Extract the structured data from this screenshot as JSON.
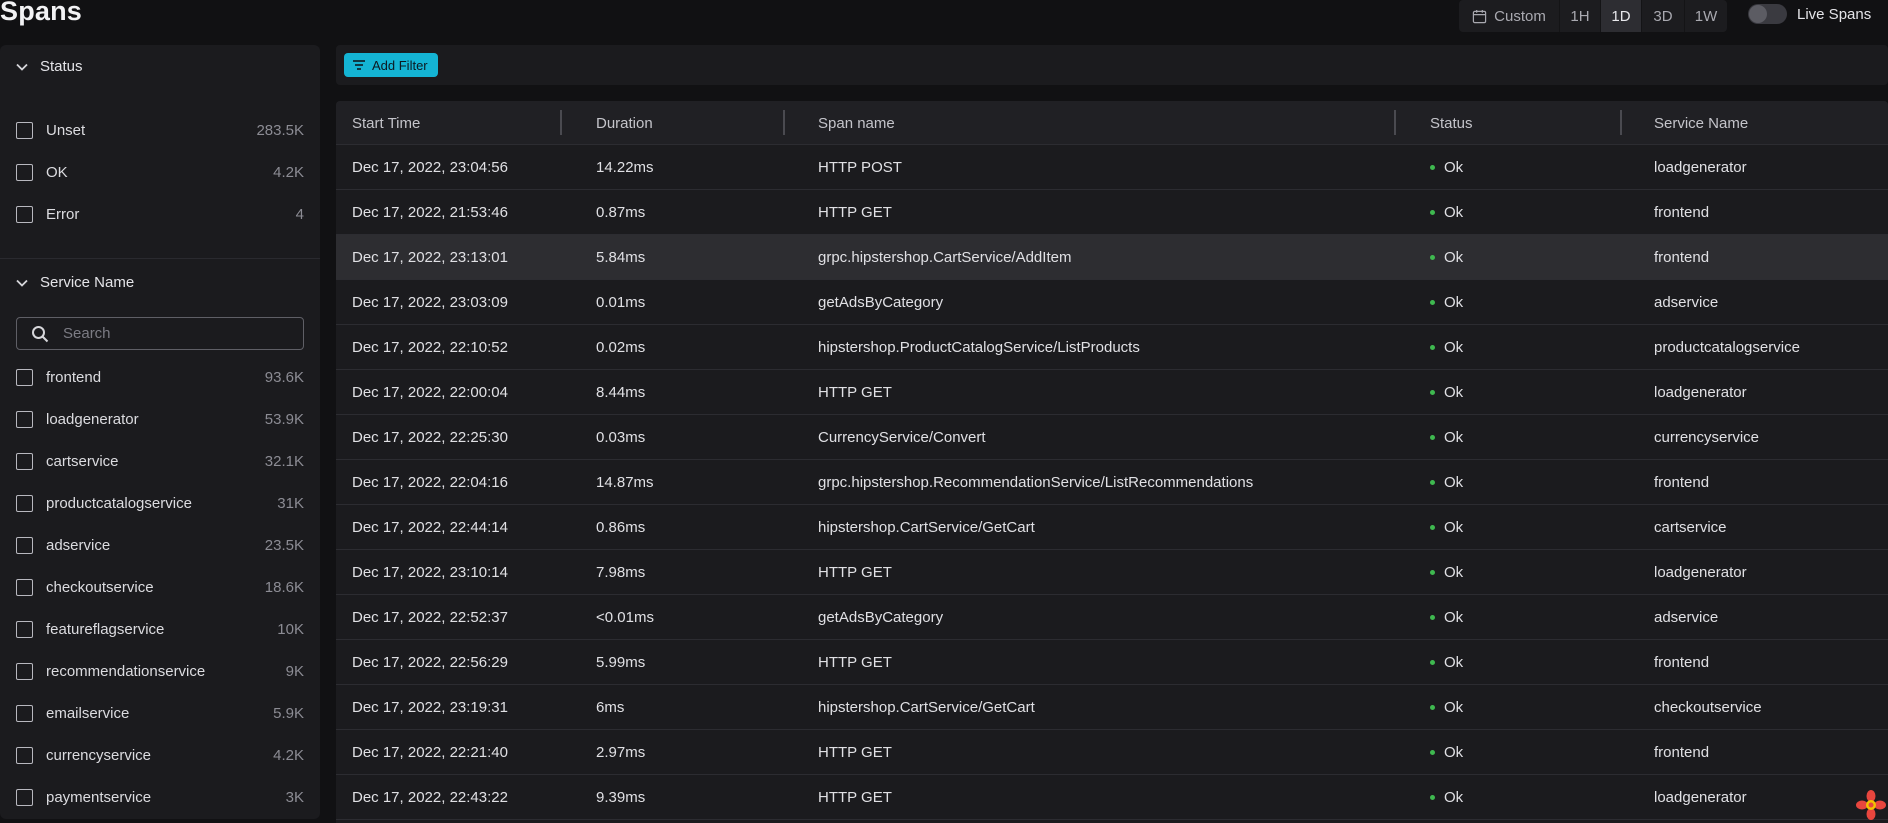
{
  "page": {
    "title": "Spans"
  },
  "time_range": {
    "options": [
      "Custom",
      "1H",
      "1D",
      "3D",
      "1W"
    ],
    "selected": "1D",
    "live_label": "Live Spans",
    "live_enabled": false
  },
  "filters": {
    "add_filter_label": "Add Filter",
    "status": {
      "title": "Status",
      "items": [
        {
          "label": "Unset",
          "count": "283.5K"
        },
        {
          "label": "OK",
          "count": "4.2K"
        },
        {
          "label": "Error",
          "count": "4"
        }
      ]
    },
    "service": {
      "title": "Service Name",
      "search_placeholder": "Search",
      "items": [
        {
          "label": "frontend",
          "count": "93.6K"
        },
        {
          "label": "loadgenerator",
          "count": "53.9K"
        },
        {
          "label": "cartservice",
          "count": "32.1K"
        },
        {
          "label": "productcatalogservice",
          "count": "31K"
        },
        {
          "label": "adservice",
          "count": "23.5K"
        },
        {
          "label": "checkoutservice",
          "count": "18.6K"
        },
        {
          "label": "featureflagservice",
          "count": "10K"
        },
        {
          "label": "recommendationservice",
          "count": "9K"
        },
        {
          "label": "emailservice",
          "count": "5.9K"
        },
        {
          "label": "currencyservice",
          "count": "4.2K"
        },
        {
          "label": "paymentservice",
          "count": "3K"
        }
      ]
    }
  },
  "table": {
    "columns": [
      "Start Time",
      "Duration",
      "Span name",
      "Status",
      "Service Name"
    ],
    "rows": [
      {
        "start": "Dec 17, 2022, 23:04:56",
        "duration": "14.22ms",
        "name": "HTTP POST",
        "status": "Ok",
        "service": "loadgenerator"
      },
      {
        "start": "Dec 17, 2022, 21:53:46",
        "duration": "0.87ms",
        "name": "HTTP GET",
        "status": "Ok",
        "service": "frontend"
      },
      {
        "start": "Dec 17, 2022, 23:13:01",
        "duration": "5.84ms",
        "name": "grpc.hipstershop.CartService/AddItem",
        "status": "Ok",
        "service": "frontend"
      },
      {
        "start": "Dec 17, 2022, 23:03:09",
        "duration": "0.01ms",
        "name": "getAdsByCategory",
        "status": "Ok",
        "service": "adservice"
      },
      {
        "start": "Dec 17, 2022, 22:10:52",
        "duration": "0.02ms",
        "name": "hipstershop.ProductCatalogService/ListProducts",
        "status": "Ok",
        "service": "productcatalogservice"
      },
      {
        "start": "Dec 17, 2022, 22:00:04",
        "duration": "8.44ms",
        "name": "HTTP GET",
        "status": "Ok",
        "service": "loadgenerator"
      },
      {
        "start": "Dec 17, 2022, 22:25:30",
        "duration": "0.03ms",
        "name": "CurrencyService/Convert",
        "status": "Ok",
        "service": "currencyservice"
      },
      {
        "start": "Dec 17, 2022, 22:04:16",
        "duration": "14.87ms",
        "name": "grpc.hipstershop.RecommendationService/ListRecommendations",
        "status": "Ok",
        "service": "frontend"
      },
      {
        "start": "Dec 17, 2022, 22:44:14",
        "duration": "0.86ms",
        "name": "hipstershop.CartService/GetCart",
        "status": "Ok",
        "service": "cartservice"
      },
      {
        "start": "Dec 17, 2022, 23:10:14",
        "duration": "7.98ms",
        "name": "HTTP GET",
        "status": "Ok",
        "service": "loadgenerator"
      },
      {
        "start": "Dec 17, 2022, 22:52:37",
        "duration": "<0.01ms",
        "name": "getAdsByCategory",
        "status": "Ok",
        "service": "adservice"
      },
      {
        "start": "Dec 17, 2022, 22:56:29",
        "duration": "5.99ms",
        "name": "HTTP GET",
        "status": "Ok",
        "service": "frontend"
      },
      {
        "start": "Dec 17, 2022, 23:19:31",
        "duration": "6ms",
        "name": "hipstershop.CartService/GetCart",
        "status": "Ok",
        "service": "checkoutservice"
      },
      {
        "start": "Dec 17, 2022, 22:21:40",
        "duration": "2.97ms",
        "name": "HTTP GET",
        "status": "Ok",
        "service": "frontend"
      },
      {
        "start": "Dec 17, 2022, 22:43:22",
        "duration": "9.39ms",
        "name": "HTTP GET",
        "status": "Ok",
        "service": "loadgenerator"
      }
    ],
    "highlighted_row": 2
  },
  "colors": {
    "accent": "#14b4d4",
    "status_ok": "#3fb950",
    "background": "#111113",
    "panel": "#1b1b1e"
  }
}
